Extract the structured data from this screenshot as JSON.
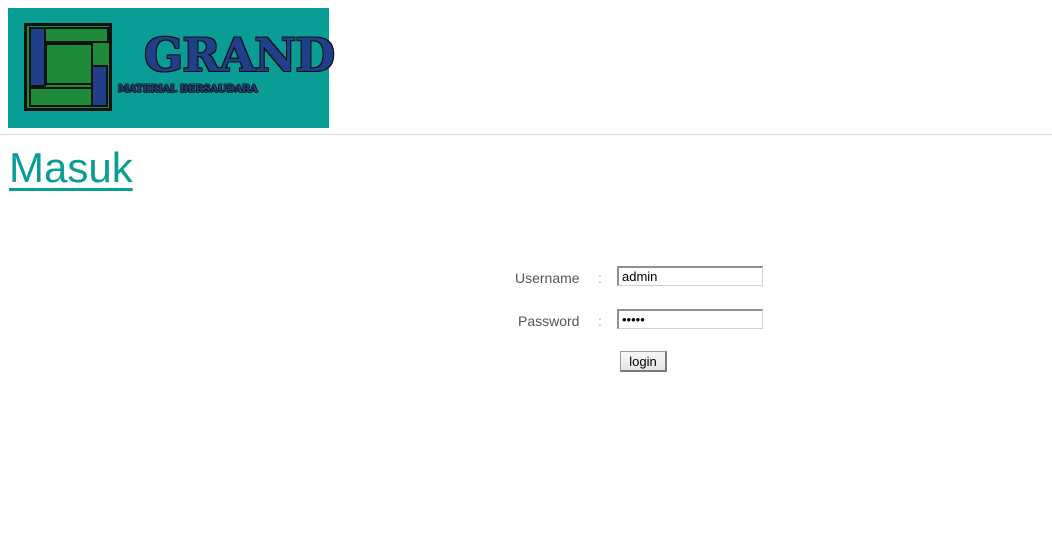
{
  "header": {
    "logo": {
      "title": "GRAND",
      "subtitle": "MATERIAL BERSAUDARA",
      "colors": {
        "background": "#0a9d96",
        "blue": "#1f3f8a",
        "green": "#1f8a3a"
      }
    }
  },
  "page": {
    "title": "Masuk",
    "accent_color": "#0a9d96"
  },
  "login_form": {
    "username_label": "Username",
    "username_value": "admin",
    "password_label": "Password",
    "password_value": "admin",
    "separator": ":",
    "submit_label": "login"
  }
}
